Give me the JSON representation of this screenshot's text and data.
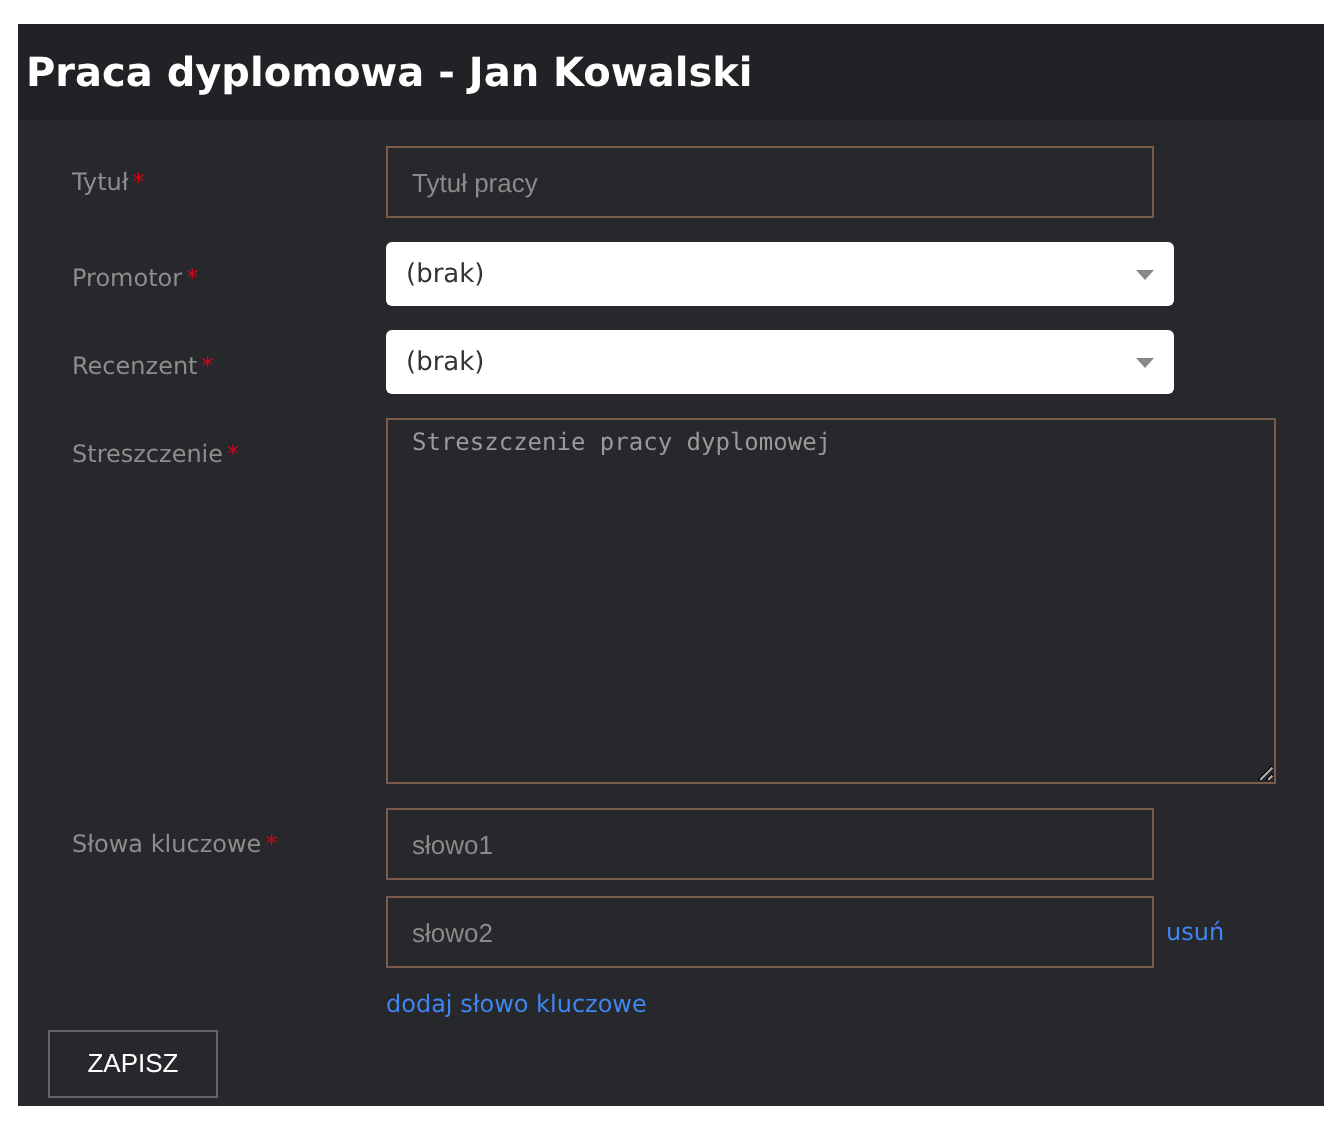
{
  "header": {
    "title": "Praca dyplomowa - Jan Kowalski"
  },
  "fields": [
    {
      "kind": "text",
      "label": "Tytuł",
      "required_mark": "*",
      "placeholder": "Tytuł pracy"
    },
    {
      "kind": "select",
      "label": "Promotor",
      "required_mark": "*",
      "value": "(brak)"
    },
    {
      "kind": "select",
      "label": "Recenzent",
      "required_mark": "*",
      "value": "(brak)"
    },
    {
      "kind": "textarea",
      "label": "Streszczenie",
      "required_mark": "*",
      "placeholder": "Streszczenie pracy dyplomowej"
    },
    {
      "kind": "keywords",
      "label": "Słowa kluczowe",
      "required_mark": "*",
      "items": [
        {
          "placeholder": "słowo1"
        },
        {
          "placeholder": "słowo2",
          "remove_link": "usuń"
        }
      ],
      "add_link": "dodaj słowo kluczowe"
    }
  ],
  "save_button": "ZAPISZ"
}
